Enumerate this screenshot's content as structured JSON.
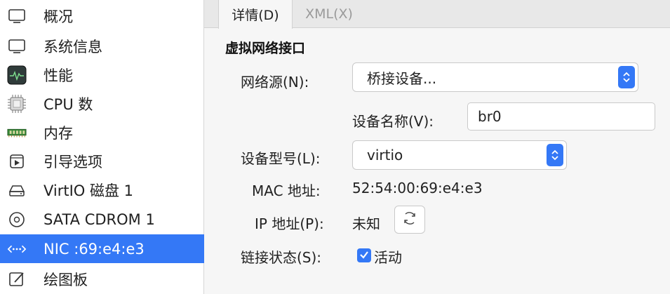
{
  "sidebar": {
    "items": [
      {
        "label": "概况",
        "icon": "monitor-icon"
      },
      {
        "label": "系统信息",
        "icon": "monitor-icon"
      },
      {
        "label": "性能",
        "icon": "performance-icon"
      },
      {
        "label": "CPU 数",
        "icon": "cpu-icon"
      },
      {
        "label": "内存",
        "icon": "memory-icon"
      },
      {
        "label": "引导选项",
        "icon": "boot-icon"
      },
      {
        "label": "VirtIO 磁盘 1",
        "icon": "disk-icon"
      },
      {
        "label": "SATA CDROM 1",
        "icon": "cdrom-icon"
      },
      {
        "label": "NIC :69:e4:e3",
        "icon": "network-icon"
      },
      {
        "label": "绘图板",
        "icon": "tablet-icon"
      }
    ],
    "selected_index": 8
  },
  "tabs": [
    {
      "label": "详情(D)"
    },
    {
      "label": "XML(X)"
    }
  ],
  "section": {
    "title": "虚拟网络接口"
  },
  "form": {
    "network_source_label": "网络源(N):",
    "network_source_value": "桥接设备...",
    "device_name_label": "设备名称(V):",
    "device_name_value": "br0",
    "device_model_label": "设备型号(L):",
    "device_model_value": "virtio",
    "mac_label": "MAC 地址:",
    "mac_value": "52:54:00:69:e4:e3",
    "ip_label": "IP 地址(P):",
    "ip_value": "未知",
    "link_state_label": "链接状态(S):",
    "link_state_value": "活动",
    "link_state_checked": true
  },
  "colors": {
    "accent": "#3478f6",
    "selection_text": "#ffffff"
  }
}
